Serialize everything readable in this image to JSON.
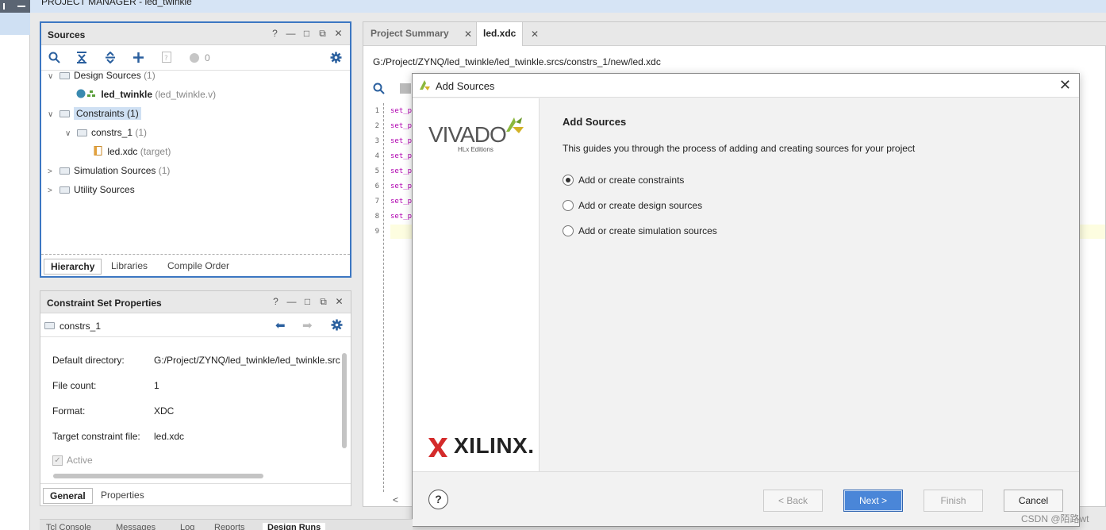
{
  "app": {
    "title": "PROJECT MANAGER - led_twinkle"
  },
  "sources": {
    "title": "Sources",
    "head_icons": [
      "?",
      "—",
      "□",
      "⧉",
      "✕"
    ],
    "status_count": "0",
    "tree": [
      {
        "label": "Design Sources",
        "count": "(1)"
      },
      {
        "label": "led_twinkle",
        "detail": "(led_twinkle.v)"
      },
      {
        "label": "Constraints (1)"
      },
      {
        "label": "constrs_1",
        "count": "(1)"
      },
      {
        "label": "led.xdc",
        "detail": "(target)"
      },
      {
        "label": "Simulation Sources",
        "count": "(1)"
      },
      {
        "label": "Utility Sources"
      }
    ],
    "tabs": [
      "Hierarchy",
      "Libraries",
      "Compile Order"
    ]
  },
  "csp": {
    "title": "Constraint Set Properties",
    "object": "constrs_1",
    "rows": [
      {
        "label": "Default directory:",
        "value": "G:/Project/ZYNQ/led_twinkle/led_twinkle.src"
      },
      {
        "label": "File count:",
        "value": "1"
      },
      {
        "label": "Format:",
        "value": "XDC"
      },
      {
        "label": "Target constraint file:",
        "value": "led.xdc"
      }
    ],
    "active_label": "Active",
    "tabs": [
      "General",
      "Properties"
    ]
  },
  "editor": {
    "tabs": [
      "Project Summary",
      "led.xdc"
    ],
    "path": "G:/Project/ZYNQ/led_twinkle/led_twinkle.srcs/constrs_1/new/led.xdc",
    "line_numbers": [
      "1",
      "2",
      "3",
      "4",
      "5",
      "6",
      "7",
      "8",
      "9"
    ],
    "code_prefix": "set_p"
  },
  "dialog": {
    "title": "Add Sources",
    "brand_top": "VIVADO",
    "brand_sub": "HLx Editions",
    "brand_bottom": "XILINX.",
    "heading": "Add Sources",
    "description": "This guides you through the process of adding and creating sources for your project",
    "options": [
      {
        "label": "Add or create constraints",
        "selected": true
      },
      {
        "label": "Add or create design sources",
        "selected": false
      },
      {
        "label": "Add or create simulation sources",
        "selected": false
      }
    ],
    "buttons": {
      "help": "?",
      "back": "< Back",
      "next": "Next >",
      "finish": "Finish",
      "cancel": "Cancel"
    }
  },
  "bottom_tabs": [
    "Tcl Console",
    "Messages",
    "Log",
    "Reports",
    "Design Runs"
  ],
  "watermark": "CSDN @陌路wt"
}
